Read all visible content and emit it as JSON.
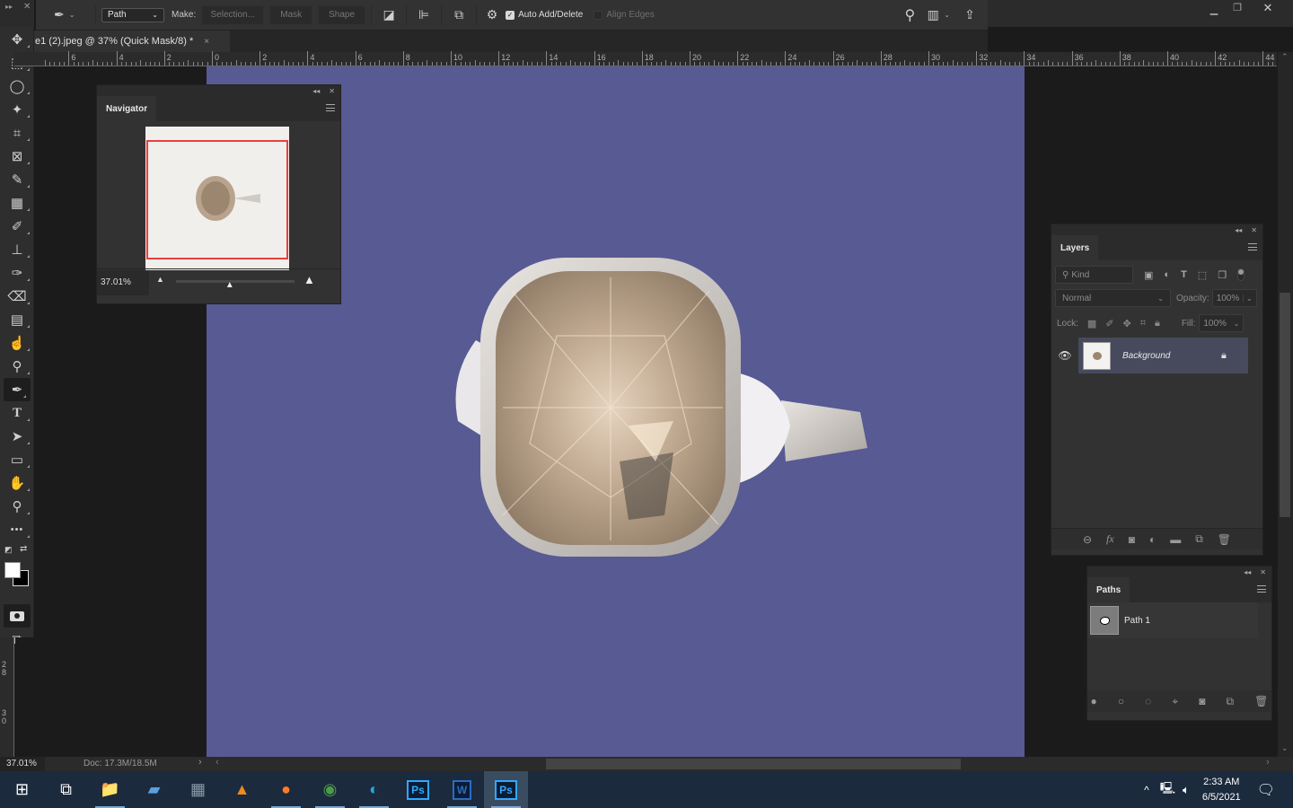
{
  "options_bar": {
    "tool_preset_icon": "pen-tool-icon",
    "mode_select": "Path",
    "make_label": "Make:",
    "selection_button": "Selection...",
    "mask_button": "Mask",
    "shape_button": "Shape",
    "path_operations_icon": "path-operations-icon",
    "path_alignment_icon": "path-alignment-icon",
    "path_arrangement_icon": "path-arrangement-icon",
    "settings_icon": "gear-icon",
    "auto_add_delete_label": "Auto Add/Delete",
    "auto_add_delete_checked": true,
    "align_edges_label": "Align Edges",
    "align_edges_checked": false
  },
  "window_controls": {
    "minimize": "minimize",
    "restore": "restore",
    "close": "close"
  },
  "document_tab": {
    "title": "e1 (2).jpeg @ 37% (Quick Mask/8) *",
    "close": "×"
  },
  "rulers": {
    "horizontal_labels": [
      "6",
      "4",
      "2",
      "0",
      "2",
      "4",
      "6",
      "8",
      "10",
      "12",
      "14",
      "16",
      "18",
      "20",
      "22",
      "24",
      "26",
      "28",
      "30",
      "32",
      "34",
      "36",
      "38",
      "40",
      "42",
      "44"
    ],
    "vertical_labels": [
      "28",
      "30"
    ]
  },
  "tools": [
    {
      "name": "move-tool",
      "glyph": "✥"
    },
    {
      "name": "rectangular-marquee-tool",
      "glyph": "⬚"
    },
    {
      "name": "lasso-tool",
      "glyph": "◯"
    },
    {
      "name": "magic-wand-tool",
      "glyph": "✦"
    },
    {
      "name": "crop-tool",
      "glyph": "⌗"
    },
    {
      "name": "frame-tool",
      "glyph": "⊠"
    },
    {
      "name": "eyedropper-tool",
      "glyph": "✎"
    },
    {
      "name": "spot-healing-tool",
      "glyph": "▦"
    },
    {
      "name": "brush-tool",
      "glyph": "✐"
    },
    {
      "name": "clone-stamp-tool",
      "glyph": "⊥"
    },
    {
      "name": "history-brush-tool",
      "glyph": "✑"
    },
    {
      "name": "eraser-tool",
      "glyph": "⌫"
    },
    {
      "name": "gradient-tool",
      "glyph": "▤"
    },
    {
      "name": "smudge-tool",
      "glyph": "☝"
    },
    {
      "name": "dodge-tool",
      "glyph": "⚲"
    },
    {
      "name": "pen-tool",
      "glyph": "✒",
      "active": true
    },
    {
      "name": "type-tool",
      "glyph": "T"
    },
    {
      "name": "path-selection-tool",
      "glyph": "➤"
    },
    {
      "name": "rectangle-tool",
      "glyph": "▭"
    },
    {
      "name": "hand-tool",
      "glyph": "✋"
    },
    {
      "name": "zoom-tool",
      "glyph": "⚲"
    },
    {
      "name": "edit-toolbar",
      "glyph": "•••"
    }
  ],
  "colors": {
    "foreground": "#ffffff",
    "background": "#000000",
    "canvas": "#575a93",
    "accent_red": "#e84040"
  },
  "navigator": {
    "title": "Navigator",
    "zoom_value": "37.01%",
    "zoom_slider_fraction": 0.37
  },
  "layers": {
    "title": "Layers",
    "filter_kind": "Kind",
    "blend_mode": "Normal",
    "opacity_label": "Opacity:",
    "opacity_value": "100%",
    "lock_label": "Lock:",
    "fill_label": "Fill:",
    "fill_value": "100%",
    "items": [
      {
        "name": "Background",
        "visible": true,
        "locked": true
      }
    ]
  },
  "paths": {
    "title": "Paths",
    "items": [
      {
        "name": "Path 1"
      }
    ]
  },
  "status_bar": {
    "zoom": "37.01%",
    "doc": "Doc: 17.3M/18.5M"
  },
  "taskbar": {
    "apps": [
      {
        "name": "task-view",
        "glyph": "⧉"
      },
      {
        "name": "file-explorer",
        "glyph": "📁",
        "running": true
      },
      {
        "name": "app-shortcut",
        "glyph": "▰"
      },
      {
        "name": "calculator",
        "glyph": "▦"
      },
      {
        "name": "vlc",
        "glyph": "▲"
      },
      {
        "name": "firefox",
        "glyph": "●",
        "running": true
      },
      {
        "name": "chrome",
        "glyph": "◉",
        "running": true
      },
      {
        "name": "edge",
        "glyph": "◐",
        "running": true
      },
      {
        "name": "photoshop",
        "glyph": "Ps"
      },
      {
        "name": "word",
        "glyph": "W",
        "running": true
      },
      {
        "name": "photoshop-active",
        "glyph": "Ps",
        "active": true
      }
    ],
    "time": "2:33 AM",
    "date": "6/5/2021"
  }
}
